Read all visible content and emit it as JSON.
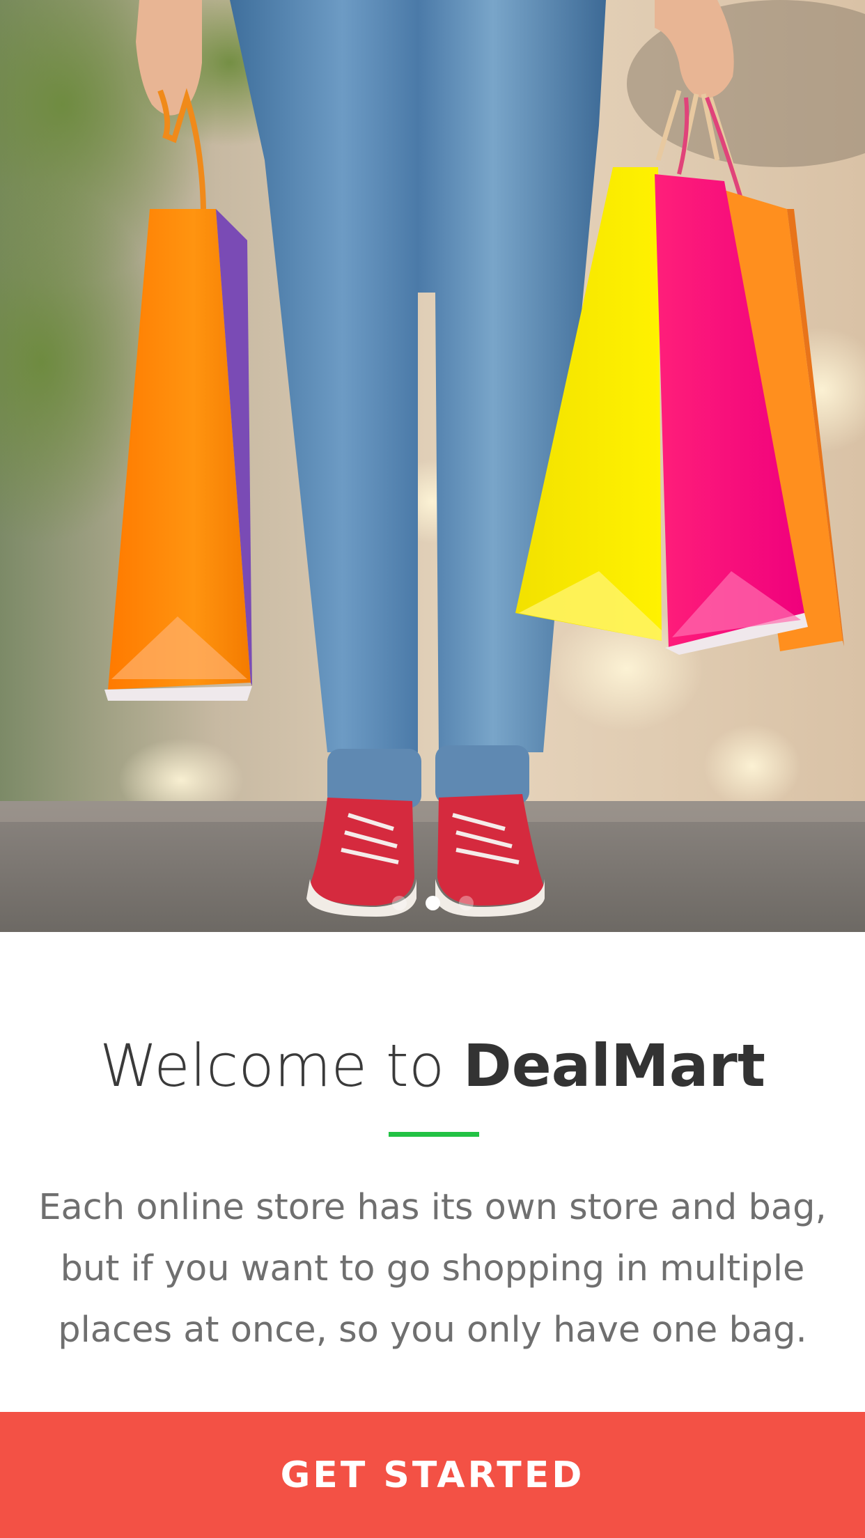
{
  "onboarding": {
    "title_prefix": "Welcome to",
    "title_brand": "DealMart",
    "description": "Each online store has its own store and bag, but if you want to go shopping in multiple places at once, so you only have one bag.",
    "cta_label": "GET STARTED"
  },
  "pager": {
    "page_count": 3,
    "active_page": 2
  },
  "hero": {
    "image_subject": "shopping-bags-photo"
  },
  "colors": {
    "accent_green": "#22c244",
    "cta_red": "#f35145",
    "title_text": "#333333",
    "body_text": "#6f6f6f"
  }
}
